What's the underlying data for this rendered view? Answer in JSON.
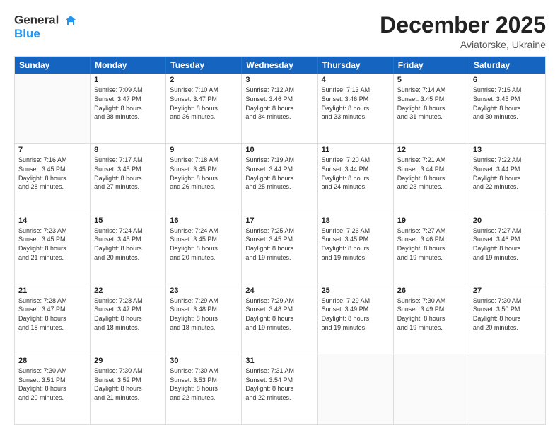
{
  "header": {
    "logo_general": "General",
    "logo_blue": "Blue",
    "month_title": "December 2025",
    "location": "Aviatorske, Ukraine"
  },
  "weekdays": [
    "Sunday",
    "Monday",
    "Tuesday",
    "Wednesday",
    "Thursday",
    "Friday",
    "Saturday"
  ],
  "weeks": [
    [
      {
        "day": "",
        "lines": []
      },
      {
        "day": "1",
        "lines": [
          "Sunrise: 7:09 AM",
          "Sunset: 3:47 PM",
          "Daylight: 8 hours",
          "and 38 minutes."
        ]
      },
      {
        "day": "2",
        "lines": [
          "Sunrise: 7:10 AM",
          "Sunset: 3:47 PM",
          "Daylight: 8 hours",
          "and 36 minutes."
        ]
      },
      {
        "day": "3",
        "lines": [
          "Sunrise: 7:12 AM",
          "Sunset: 3:46 PM",
          "Daylight: 8 hours",
          "and 34 minutes."
        ]
      },
      {
        "day": "4",
        "lines": [
          "Sunrise: 7:13 AM",
          "Sunset: 3:46 PM",
          "Daylight: 8 hours",
          "and 33 minutes."
        ]
      },
      {
        "day": "5",
        "lines": [
          "Sunrise: 7:14 AM",
          "Sunset: 3:45 PM",
          "Daylight: 8 hours",
          "and 31 minutes."
        ]
      },
      {
        "day": "6",
        "lines": [
          "Sunrise: 7:15 AM",
          "Sunset: 3:45 PM",
          "Daylight: 8 hours",
          "and 30 minutes."
        ]
      }
    ],
    [
      {
        "day": "7",
        "lines": [
          "Sunrise: 7:16 AM",
          "Sunset: 3:45 PM",
          "Daylight: 8 hours",
          "and 28 minutes."
        ]
      },
      {
        "day": "8",
        "lines": [
          "Sunrise: 7:17 AM",
          "Sunset: 3:45 PM",
          "Daylight: 8 hours",
          "and 27 minutes."
        ]
      },
      {
        "day": "9",
        "lines": [
          "Sunrise: 7:18 AM",
          "Sunset: 3:45 PM",
          "Daylight: 8 hours",
          "and 26 minutes."
        ]
      },
      {
        "day": "10",
        "lines": [
          "Sunrise: 7:19 AM",
          "Sunset: 3:44 PM",
          "Daylight: 8 hours",
          "and 25 minutes."
        ]
      },
      {
        "day": "11",
        "lines": [
          "Sunrise: 7:20 AM",
          "Sunset: 3:44 PM",
          "Daylight: 8 hours",
          "and 24 minutes."
        ]
      },
      {
        "day": "12",
        "lines": [
          "Sunrise: 7:21 AM",
          "Sunset: 3:44 PM",
          "Daylight: 8 hours",
          "and 23 minutes."
        ]
      },
      {
        "day": "13",
        "lines": [
          "Sunrise: 7:22 AM",
          "Sunset: 3:44 PM",
          "Daylight: 8 hours",
          "and 22 minutes."
        ]
      }
    ],
    [
      {
        "day": "14",
        "lines": [
          "Sunrise: 7:23 AM",
          "Sunset: 3:45 PM",
          "Daylight: 8 hours",
          "and 21 minutes."
        ]
      },
      {
        "day": "15",
        "lines": [
          "Sunrise: 7:24 AM",
          "Sunset: 3:45 PM",
          "Daylight: 8 hours",
          "and 20 minutes."
        ]
      },
      {
        "day": "16",
        "lines": [
          "Sunrise: 7:24 AM",
          "Sunset: 3:45 PM",
          "Daylight: 8 hours",
          "and 20 minutes."
        ]
      },
      {
        "day": "17",
        "lines": [
          "Sunrise: 7:25 AM",
          "Sunset: 3:45 PM",
          "Daylight: 8 hours",
          "and 19 minutes."
        ]
      },
      {
        "day": "18",
        "lines": [
          "Sunrise: 7:26 AM",
          "Sunset: 3:45 PM",
          "Daylight: 8 hours",
          "and 19 minutes."
        ]
      },
      {
        "day": "19",
        "lines": [
          "Sunrise: 7:27 AM",
          "Sunset: 3:46 PM",
          "Daylight: 8 hours",
          "and 19 minutes."
        ]
      },
      {
        "day": "20",
        "lines": [
          "Sunrise: 7:27 AM",
          "Sunset: 3:46 PM",
          "Daylight: 8 hours",
          "and 19 minutes."
        ]
      }
    ],
    [
      {
        "day": "21",
        "lines": [
          "Sunrise: 7:28 AM",
          "Sunset: 3:47 PM",
          "Daylight: 8 hours",
          "and 18 minutes."
        ]
      },
      {
        "day": "22",
        "lines": [
          "Sunrise: 7:28 AM",
          "Sunset: 3:47 PM",
          "Daylight: 8 hours",
          "and 18 minutes."
        ]
      },
      {
        "day": "23",
        "lines": [
          "Sunrise: 7:29 AM",
          "Sunset: 3:48 PM",
          "Daylight: 8 hours",
          "and 18 minutes."
        ]
      },
      {
        "day": "24",
        "lines": [
          "Sunrise: 7:29 AM",
          "Sunset: 3:48 PM",
          "Daylight: 8 hours",
          "and 19 minutes."
        ]
      },
      {
        "day": "25",
        "lines": [
          "Sunrise: 7:29 AM",
          "Sunset: 3:49 PM",
          "Daylight: 8 hours",
          "and 19 minutes."
        ]
      },
      {
        "day": "26",
        "lines": [
          "Sunrise: 7:30 AM",
          "Sunset: 3:49 PM",
          "Daylight: 8 hours",
          "and 19 minutes."
        ]
      },
      {
        "day": "27",
        "lines": [
          "Sunrise: 7:30 AM",
          "Sunset: 3:50 PM",
          "Daylight: 8 hours",
          "and 20 minutes."
        ]
      }
    ],
    [
      {
        "day": "28",
        "lines": [
          "Sunrise: 7:30 AM",
          "Sunset: 3:51 PM",
          "Daylight: 8 hours",
          "and 20 minutes."
        ]
      },
      {
        "day": "29",
        "lines": [
          "Sunrise: 7:30 AM",
          "Sunset: 3:52 PM",
          "Daylight: 8 hours",
          "and 21 minutes."
        ]
      },
      {
        "day": "30",
        "lines": [
          "Sunrise: 7:30 AM",
          "Sunset: 3:53 PM",
          "Daylight: 8 hours",
          "and 22 minutes."
        ]
      },
      {
        "day": "31",
        "lines": [
          "Sunrise: 7:31 AM",
          "Sunset: 3:54 PM",
          "Daylight: 8 hours",
          "and 22 minutes."
        ]
      },
      {
        "day": "",
        "lines": []
      },
      {
        "day": "",
        "lines": []
      },
      {
        "day": "",
        "lines": []
      }
    ]
  ]
}
